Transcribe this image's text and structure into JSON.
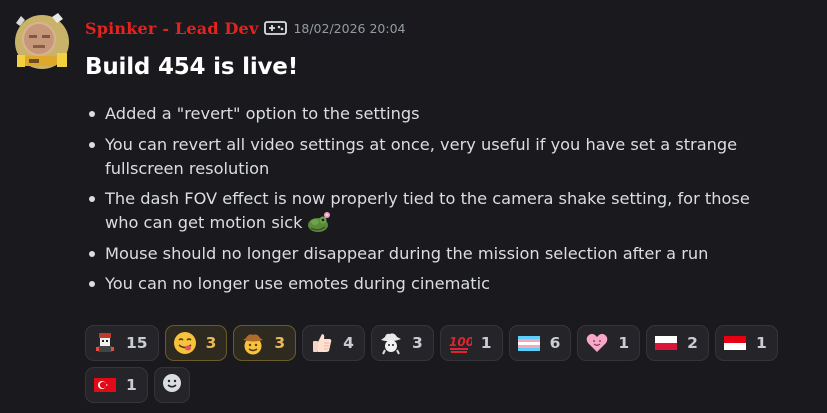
{
  "author": {
    "name": "Spinker - Lead Dev",
    "role_icon": "dev-badge-icon",
    "timestamp": "18/02/2026 20:04",
    "name_color": "#e4231f"
  },
  "message": {
    "title": "Build 454 is live!",
    "bullets": [
      "Added a \"revert\" option to the settings",
      "You can revert all video settings at once, very useful if you have set a strange fullscreen resolution",
      "The dash FOV effect is now properly tied to the camera shake setting, for those who can get motion sick",
      "Mouse should no longer disappear during the mission selection after a run",
      "You can no longer use emotes during cinematic"
    ],
    "bullet3_emoji": "sick-frog-emoji"
  },
  "reactions": [
    {
      "emoji": "custom-character-emoji",
      "count": "15",
      "me": false
    },
    {
      "emoji": "savoring-face-emoji",
      "count": "3",
      "me": true
    },
    {
      "emoji": "cowboy-face-emoji",
      "count": "3",
      "me": true
    },
    {
      "emoji": "thumbs-up-emoji",
      "count": "4",
      "me": false
    },
    {
      "emoji": "custom-cowboy-emoji",
      "count": "3",
      "me": false
    },
    {
      "emoji": "hundred-points-emoji",
      "count": "1",
      "me": false
    },
    {
      "emoji": "transgender-flag-emoji",
      "count": "6",
      "me": false
    },
    {
      "emoji": "pink-heart-emoji",
      "count": "1",
      "me": false
    },
    {
      "emoji": "poland-flag-emoji",
      "count": "2",
      "me": false
    },
    {
      "emoji": "indonesia-flag-emoji",
      "count": "1",
      "me": false
    },
    {
      "emoji": "turkey-flag-emoji",
      "count": "1",
      "me": false
    }
  ],
  "add_reaction_icon": "add-reaction-smiley-icon"
}
